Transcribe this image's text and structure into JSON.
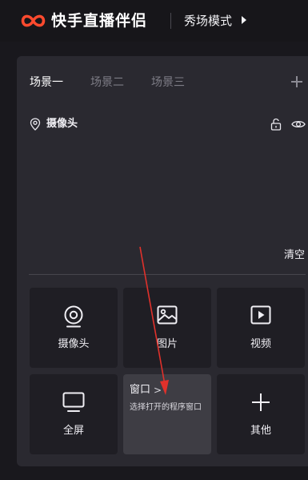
{
  "header": {
    "app_title": "快手直播伴侣",
    "mode_label": "秀场模式"
  },
  "scenes": {
    "tabs": [
      {
        "label": "场景一",
        "active": true
      },
      {
        "label": "场景二",
        "active": false
      },
      {
        "label": "场景三",
        "active": false
      }
    ]
  },
  "source": {
    "label": "摄像头"
  },
  "preview": {
    "clear_label": "清空"
  },
  "tiles": [
    {
      "label": "摄像头",
      "icon": "webcam-icon"
    },
    {
      "label": "图片",
      "icon": "image-icon"
    },
    {
      "label": "视频",
      "icon": "video-icon"
    },
    {
      "label": "全屏",
      "icon": "monitor-icon"
    },
    {
      "label": "窗口",
      "description": "选择打开的程序窗口",
      "icon": "window-icon"
    },
    {
      "label": "其他",
      "icon": "plus-icon"
    }
  ],
  "colors": {
    "brand": "#ff4a2e",
    "annotation": "#e0312b",
    "panel": "#2a2930",
    "tile": "#1f1e24"
  }
}
